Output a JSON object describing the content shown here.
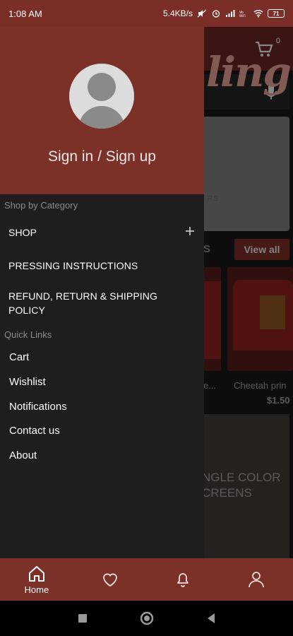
{
  "status_bar": {
    "time": "1:08 AM",
    "speed": "5.4KB/s",
    "battery": "71"
  },
  "app": {
    "cart_count": "0",
    "banner_text": "ling",
    "banner_sub": "RS",
    "section_tail": "S",
    "view_all": "View all",
    "products": [
      {
        "name": "e...",
        "price": ""
      },
      {
        "name": "Cheetah prin",
        "price": "$1.50"
      }
    ],
    "promo_text": "NGLE COLOR CREENS"
  },
  "drawer": {
    "signin_label": "Sign in / Sign up",
    "shop_by_category_label": "Shop by Category",
    "categories": [
      {
        "label": "SHOP"
      },
      {
        "label": "PRESSING INSTRUCTIONS"
      },
      {
        "label": "REFUND, RETURN & SHIPPING POLICY"
      }
    ],
    "quick_links_label": "Quick Links",
    "quick_links": [
      {
        "label": "Cart"
      },
      {
        "label": "Wishlist"
      },
      {
        "label": "Notifications"
      },
      {
        "label": "Contact us"
      },
      {
        "label": "About"
      }
    ]
  },
  "bottom_nav": {
    "home_label": "Home",
    "icons": [
      "home-icon",
      "heart-icon",
      "bell-icon",
      "person-icon"
    ]
  },
  "colors": {
    "accent": "#7b3028",
    "drawer_bg": "#1e1e1e"
  }
}
